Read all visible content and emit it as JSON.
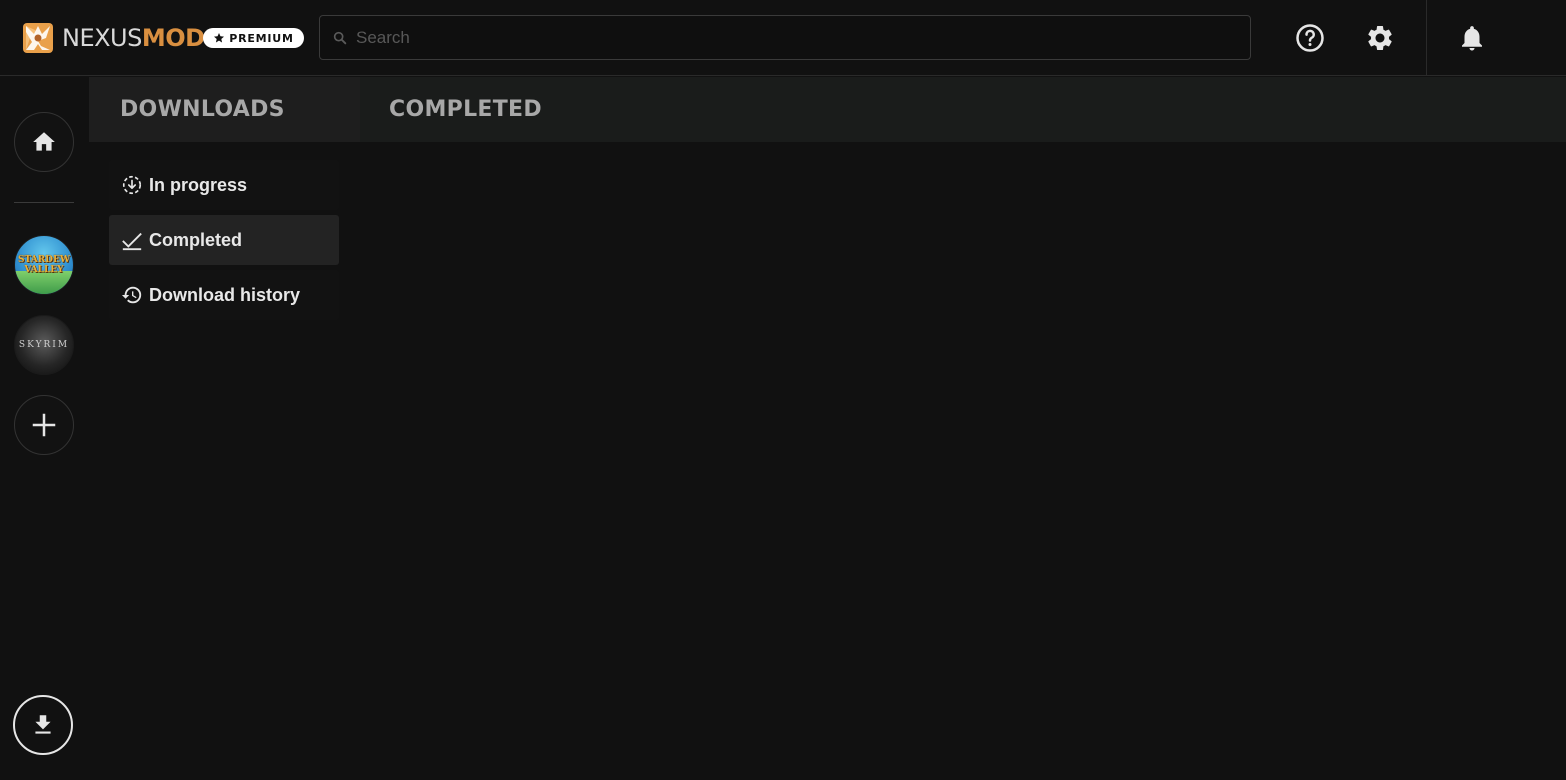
{
  "header": {
    "logo_word1": "NEXUS",
    "logo_word2": "MODS",
    "premium_label": "PREMIUM",
    "search_placeholder": "Search",
    "icons": [
      "help-icon",
      "gear-icon",
      "bell-icon"
    ]
  },
  "sidebar": {
    "home_icon": "home-icon",
    "games": [
      {
        "name": "Stardew Valley",
        "art_text_line1": "STARDEW",
        "art_text_line2": "VALLEY"
      },
      {
        "name": "Skyrim",
        "art_text": "SKYRIM"
      }
    ],
    "add_icon": "plus-icon",
    "download_icon": "download-icon"
  },
  "tabs": {
    "downloads": "DOWNLOADS",
    "completed": "COMPLETED"
  },
  "submenu": {
    "items": [
      {
        "label": "In progress",
        "icon": "in-progress-icon",
        "active": false
      },
      {
        "label": "Completed",
        "icon": "check-icon",
        "active": true
      },
      {
        "label": "Download history",
        "icon": "history-icon",
        "active": false
      }
    ]
  },
  "colors": {
    "background": "#111111",
    "panel": "#1a1c1b",
    "accent": "#d98f40",
    "active_item": "#232323"
  }
}
